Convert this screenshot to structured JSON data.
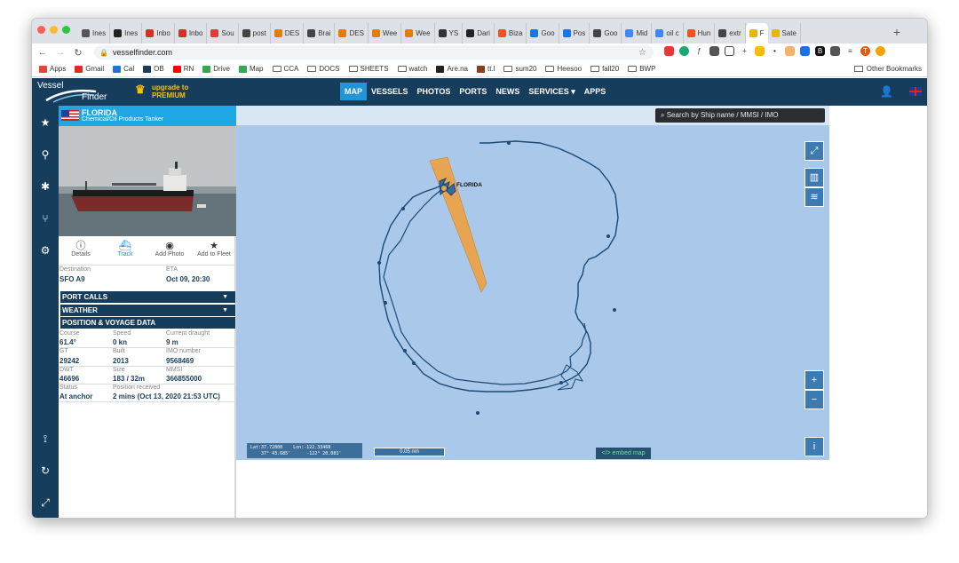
{
  "browser": {
    "tabs": [
      {
        "label": "Ines",
        "color": "#555"
      },
      {
        "label": "Ines",
        "color": "#222"
      },
      {
        "label": "Inbo",
        "color": "#d93025"
      },
      {
        "label": "Inbo",
        "color": "#d93025"
      },
      {
        "label": "Sou",
        "color": "#e53935"
      },
      {
        "label": "post",
        "color": "#444"
      },
      {
        "label": "DES",
        "color": "#e67c00"
      },
      {
        "label": "Brai",
        "color": "#444"
      },
      {
        "label": "DES",
        "color": "#e67c00"
      },
      {
        "label": "Wee",
        "color": "#e67c00"
      },
      {
        "label": "Wee",
        "color": "#e67c00"
      },
      {
        "label": "YS",
        "color": "#333"
      },
      {
        "label": "Dari",
        "color": "#222"
      },
      {
        "label": "Biza",
        "color": "#f4511e"
      },
      {
        "label": "Goo",
        "color": "#1a73e8"
      },
      {
        "label": "Pos",
        "color": "#1a73e8"
      },
      {
        "label": "Goo",
        "color": "#444"
      },
      {
        "label": "Mid",
        "color": "#4285f4"
      },
      {
        "label": "oil c",
        "color": "#4285f4"
      },
      {
        "label": "Hun",
        "color": "#f4511e"
      },
      {
        "label": "extr",
        "color": "#444"
      },
      {
        "label": "F",
        "color": "#e6b800"
      },
      {
        "label": "Sate",
        "color": "#e6b800"
      }
    ],
    "new_tab": "+",
    "url": "vesselfinder.com",
    "bookmarks": [
      {
        "label": "Apps",
        "color": "#ea4335"
      },
      {
        "label": "Gmail",
        "color": "#d93025"
      },
      {
        "label": "Cal",
        "color": "#1a73e8"
      },
      {
        "label": "OB",
        "color": "#173d5c"
      },
      {
        "label": "RN",
        "color": "#ff0000"
      },
      {
        "label": "Drive",
        "color": "#34a853"
      },
      {
        "label": "Map",
        "color": "#34a853"
      },
      {
        "label": "CCA",
        "color": "folder"
      },
      {
        "label": "DOCS",
        "color": "folder"
      },
      {
        "label": "SHEETS",
        "color": "folder"
      },
      {
        "label": "watch",
        "color": "folder"
      },
      {
        "label": "Are.na",
        "color": "#222"
      },
      {
        "label": "tt.l",
        "color": "#8d3c1c"
      },
      {
        "label": "sum20",
        "color": "folder"
      },
      {
        "label": "Heesoo",
        "color": "folder"
      },
      {
        "label": "fall20",
        "color": "folder"
      },
      {
        "label": "BWP",
        "color": "folder"
      }
    ],
    "other_bookmarks": "Other Bookmarks"
  },
  "site": {
    "logo_top": "Vessel",
    "logo_bottom": "Finder",
    "premium_line1": "upgrade to",
    "premium_line2": "PREMIUM",
    "nav": [
      "MAP",
      "VESSELS",
      "PHOTOS",
      "PORTS",
      "NEWS",
      "SERVICES ▾",
      "APPS"
    ],
    "active_nav": "MAP"
  },
  "vessel": {
    "name": "FLORIDA",
    "type": "Chemical/Oil Products Tanker",
    "actions": [
      "Details",
      "Track",
      "Add Photo",
      "Add to Fleet"
    ],
    "labels": {
      "destination": "Destination",
      "eta": "ETA",
      "course": "Course",
      "speed": "Speed",
      "draught": "Current draught",
      "gt": "GT",
      "built": "Built",
      "imo": "IMO number",
      "dwt": "DWT",
      "size": "Size",
      "mmsi": "MMSI",
      "status": "Status",
      "position": "Position received"
    },
    "values": {
      "destination": "SFO A9",
      "eta": "Oct 09, 20:30",
      "course": "61.4°",
      "speed": "0 kn",
      "draught": "9 m",
      "gt": "29242",
      "built": "2013",
      "imo": "9568469",
      "dwt": "46696",
      "size": "183 / 32m",
      "mmsi": "366855000",
      "status": "At anchor",
      "position": "2 mins (Oct 13, 2020 21:53 UTC)"
    },
    "sections": [
      "PORT CALLS",
      "WEATHER",
      "POSITION & VOYAGE DATA"
    ]
  },
  "map": {
    "search_placeholder": "Search by Ship name / MMSI / IMO",
    "ship_label": "FLORIDA",
    "coords_line1": "Lat:37.72808    Lon:-122.33468",
    "coords_line2": "    37° 43.685'      -122° 20.081'",
    "scale": "0.05 nm",
    "embed": "</> embed map",
    "zoom_in": "+",
    "zoom_out": "−",
    "info": "i",
    "track_color": "#1b4a74",
    "heading_color": "#e7a451"
  }
}
